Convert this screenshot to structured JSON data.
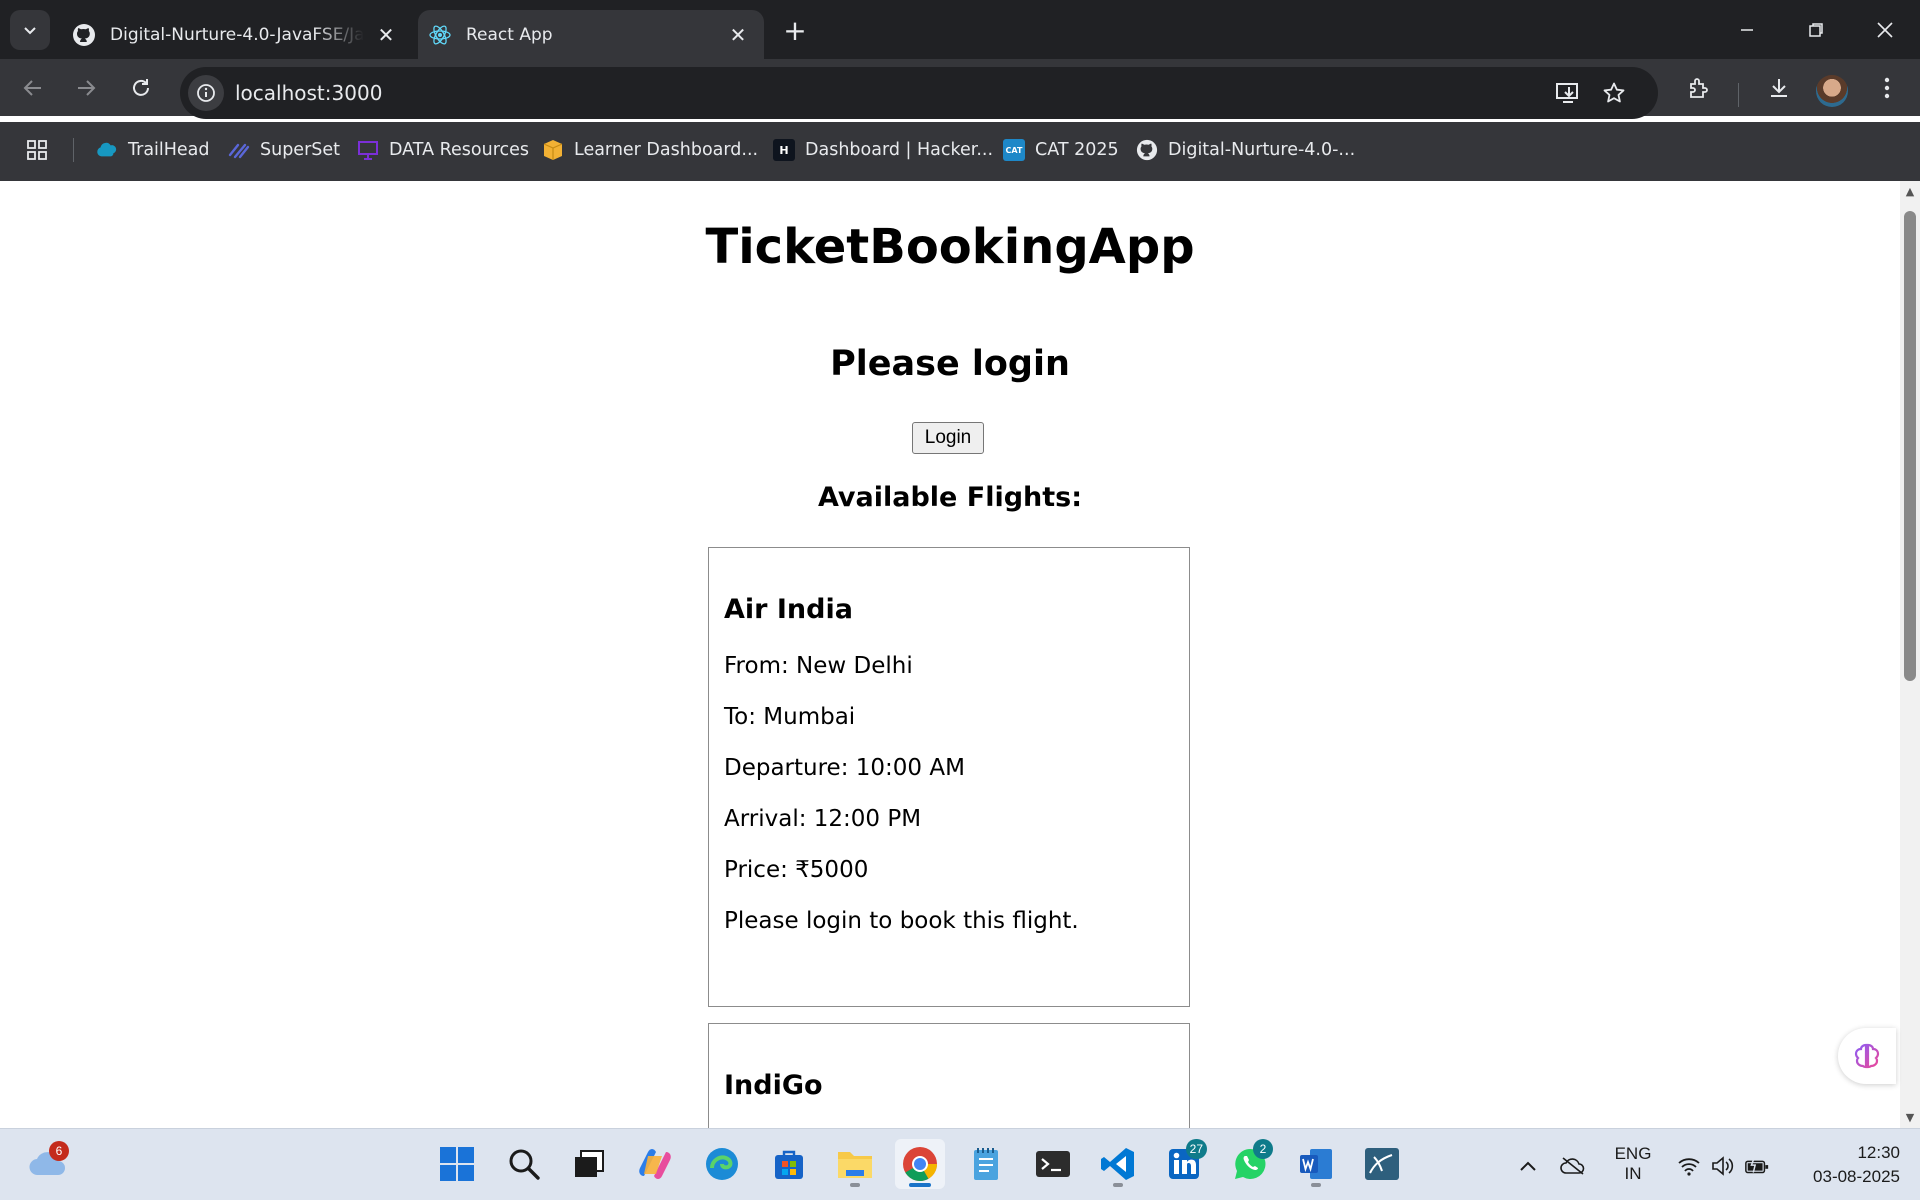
{
  "browser": {
    "tabs": [
      {
        "title": "Digital-Nurture-4.0-JavaFSE/Jav",
        "icon": "github-icon",
        "active": false
      },
      {
        "title": "React App",
        "icon": "react-icon",
        "active": true
      }
    ],
    "url": "localhost:3000",
    "bookmarks": [
      {
        "label": "TrailHead",
        "icon": "salesforce-cloud-icon",
        "color": "#1798c1"
      },
      {
        "label": "SuperSet",
        "icon": "superset-icon",
        "color": "#5a67d8"
      },
      {
        "label": "DATA Resources",
        "icon": "presentation-icon",
        "color": "#7b2fd8"
      },
      {
        "label": "Learner Dashboard...",
        "icon": "box-icon",
        "color": "#f2b134"
      },
      {
        "label": "Dashboard | Hacker...",
        "icon": "hackerrank-icon",
        "color": "#0e141e"
      },
      {
        "label": "CAT 2025",
        "icon": "cat-icon",
        "color": "#1e88c8",
        "icon_text": "CAT"
      },
      {
        "label": "Digital-Nurture-4.0-...",
        "icon": "github-icon",
        "color": "#ffffff"
      }
    ]
  },
  "page": {
    "app_title": "TicketBookingApp",
    "login_heading": "Please login",
    "login_button": "Login",
    "flights_heading": "Available Flights:",
    "flights": [
      {
        "airline": "Air India",
        "from": "From: New Delhi",
        "to": "To: Mumbai",
        "departure": "Departure: 10:00 AM",
        "arrival": "Arrival: 12:00 PM",
        "price": "Price: ₹5000",
        "note": "Please login to book this flight."
      },
      {
        "airline": "IndiGo"
      }
    ]
  },
  "taskbar": {
    "weather_badge": "6",
    "linkedin_badge": "27",
    "whatsapp_badge": "2",
    "language_top": "ENG",
    "language_bottom": "IN",
    "time": "12:30",
    "date": "03-08-2025"
  },
  "colors": {
    "chrome_dark": "#202124",
    "chrome_toolbar": "#35363a",
    "taskbar_bg": "#dde4ef",
    "badge_red": "#c42b1c",
    "badge_teal": "#0f7b8a"
  }
}
